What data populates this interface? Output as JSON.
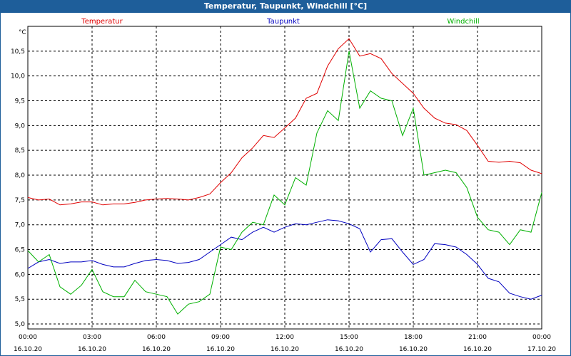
{
  "window": {
    "title": "Temperatur, Taupunkt, Windchill [°C]"
  },
  "chart_data": {
    "type": "line",
    "title": "Temperatur, Taupunkt, Windchill [°C]",
    "ylabel": "°C",
    "ylim": [
      4.9,
      11.0
    ],
    "xlim": [
      0,
      24
    ],
    "grid": true,
    "legend_placement": "top",
    "y_ticks": [
      "5,0",
      "5,5",
      "6,0",
      "6,5",
      "7,0",
      "7,5",
      "8,0",
      "8,5",
      "9,0",
      "9,5",
      "10,0",
      "10,5"
    ],
    "x_ticks": [
      {
        "time": "00:00",
        "date": "16.10.20"
      },
      {
        "time": "03:00",
        "date": "16.10.20"
      },
      {
        "time": "06:00",
        "date": "16.10.20"
      },
      {
        "time": "09:00",
        "date": "16.10.20"
      },
      {
        "time": "12:00",
        "date": "16.10.20"
      },
      {
        "time": "15:00",
        "date": "16.10.20"
      },
      {
        "time": "18:00",
        "date": "16.10.20"
      },
      {
        "time": "21:00",
        "date": "16.10.20"
      },
      {
        "time": "00:00",
        "date": "17.10.20"
      }
    ],
    "series": [
      {
        "name": "Temperatur",
        "color": "#e00000",
        "x": [
          0,
          0.5,
          1,
          1.5,
          2,
          2.5,
          3,
          3.5,
          4,
          4.5,
          5,
          5.5,
          6,
          6.5,
          7,
          7.5,
          8,
          8.5,
          9,
          9.5,
          10,
          10.5,
          11,
          11.5,
          12,
          12.5,
          13,
          13.5,
          14,
          14.5,
          15,
          15.5,
          16,
          16.5,
          17,
          17.5,
          18,
          18.5,
          19,
          19.5,
          20,
          20.5,
          21,
          21.5,
          22,
          22.5,
          23,
          23.5,
          24
        ],
        "y": [
          7.55,
          7.5,
          7.52,
          7.4,
          7.42,
          7.46,
          7.46,
          7.4,
          7.42,
          7.42,
          7.45,
          7.5,
          7.52,
          7.53,
          7.52,
          7.5,
          7.55,
          7.62,
          7.85,
          8.05,
          8.35,
          8.55,
          8.8,
          8.76,
          8.95,
          9.15,
          9.55,
          9.65,
          10.2,
          10.55,
          10.75,
          10.4,
          10.45,
          10.35,
          10.05,
          9.85,
          9.65,
          9.35,
          9.15,
          9.05,
          9.02,
          8.9,
          8.6,
          8.28,
          8.26,
          8.28,
          8.25,
          8.1,
          8.03
        ]
      },
      {
        "name": "Taupunkt",
        "color": "#0000c0",
        "x": [
          0,
          0.5,
          1,
          1.5,
          2,
          2.5,
          3,
          3.5,
          4,
          4.5,
          5,
          5.5,
          6,
          6.5,
          7,
          7.5,
          8,
          8.5,
          9,
          9.5,
          10,
          10.5,
          11,
          11.5,
          12,
          12.5,
          13,
          13.5,
          14,
          14.5,
          15,
          15.5,
          16,
          16.5,
          17,
          17.5,
          18,
          18.5,
          19,
          19.5,
          20,
          20.5,
          21,
          21.5,
          22,
          22.5,
          23,
          23.5,
          24
        ],
        "y": [
          6.12,
          6.25,
          6.3,
          6.22,
          6.25,
          6.25,
          6.28,
          6.2,
          6.15,
          6.15,
          6.22,
          6.28,
          6.3,
          6.28,
          6.22,
          6.24,
          6.3,
          6.45,
          6.6,
          6.75,
          6.7,
          6.85,
          6.95,
          6.85,
          6.95,
          7.02,
          7.0,
          7.05,
          7.1,
          7.08,
          7.02,
          6.92,
          6.45,
          6.7,
          6.72,
          6.45,
          6.2,
          6.3,
          6.62,
          6.6,
          6.55,
          6.4,
          6.2,
          5.92,
          5.85,
          5.62,
          5.55,
          5.5,
          5.58
        ]
      },
      {
        "name": "Windchill",
        "color": "#00b000",
        "x": [
          0,
          0.5,
          1,
          1.5,
          2,
          2.5,
          3,
          3.5,
          4,
          4.5,
          5,
          5.5,
          6,
          6.5,
          7,
          7.5,
          8,
          8.5,
          9,
          9.5,
          10,
          10.5,
          11,
          11.5,
          12,
          12.5,
          13,
          13.5,
          14,
          14.5,
          15,
          15.5,
          16,
          16.5,
          17,
          17.5,
          18,
          18.5,
          19,
          19.5,
          20,
          20.5,
          21,
          21.5,
          22,
          22.5,
          23,
          23.5,
          24
        ],
        "y": [
          6.48,
          6.25,
          6.4,
          5.75,
          5.6,
          5.78,
          6.1,
          5.65,
          5.55,
          5.55,
          5.88,
          5.65,
          5.6,
          5.55,
          5.2,
          5.4,
          5.45,
          5.6,
          6.55,
          6.5,
          6.85,
          7.05,
          7.0,
          7.6,
          7.4,
          7.95,
          7.8,
          8.85,
          9.3,
          9.1,
          10.5,
          9.35,
          9.7,
          9.55,
          9.5,
          8.8,
          9.35,
          8.0,
          8.05,
          8.1,
          8.05,
          7.75,
          7.15,
          6.9,
          6.85,
          6.6,
          6.9,
          6.85,
          7.65
        ]
      }
    ]
  }
}
